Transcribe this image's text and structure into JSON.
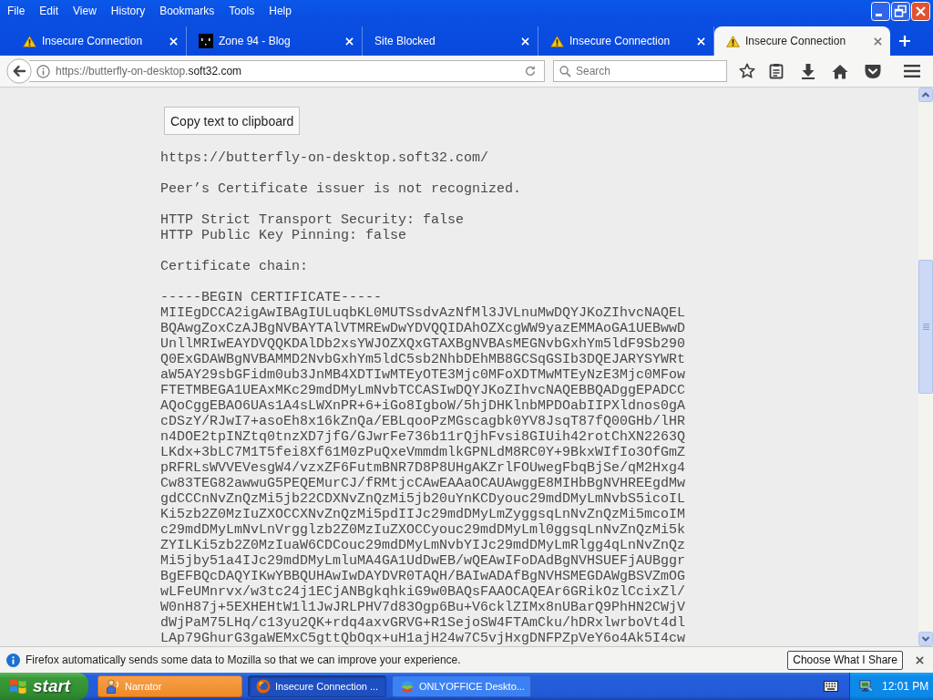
{
  "menu_bar": {
    "items": [
      "File",
      "Edit",
      "View",
      "History",
      "Bookmarks",
      "Tools",
      "Help"
    ]
  },
  "tabs": [
    {
      "title": "Insecure Connection",
      "kind": "warning",
      "selected": false
    },
    {
      "title": "Zone 94 - Blog",
      "kind": "site",
      "selected": false
    },
    {
      "title": "Site Blocked",
      "kind": "plain",
      "selected": false
    },
    {
      "title": "Insecure Connection",
      "kind": "warning",
      "selected": false
    },
    {
      "title": "Insecure Connection",
      "kind": "warning",
      "selected": true
    }
  ],
  "address_bar": {
    "url_prefix": "https://butterfly-on-desktop.",
    "url_domain": "soft32.com"
  },
  "search": {
    "placeholder": "Search"
  },
  "page": {
    "button": "Copy text to clipboard",
    "site_url": "https://butterfly-on-desktop.soft32.com/",
    "error": "Peer’s Certificate issuer is not recognized.",
    "security": [
      "HTTP Strict Transport Security: false",
      "HTTP Public Key Pinning: false"
    ],
    "chain_heading": "Certificate chain:",
    "certificate": [
      "-----BEGIN CERTIFICATE-----",
      "MIIEgDCCA2igAwIBAgIULuqbKL0MUTSsdvAzNfMl3JVLnuMwDQYJKoZIhvcNAQEL",
      "BQAwgZoxCzAJBgNVBAYTAlVTMREwDwYDVQQIDAhOZXcgWW9yazEMMAoGA1UEBwwD",
      "UnllMRIwEAYDVQQKDAlDb2xsYWJOZXQxGTAXBgNVBAsMEGNvbGxhYm5ldF9Sb290",
      "Q0ExGDAWBgNVBAMMD2NvbGxhYm5ldC5sb2NhbDEhMB8GCSqGSIb3DQEJARYSYWRt",
      "aW5AY29sbGFidm0ub3JnMB4XDTIwMTEyOTE3Mjc0MFoXDTMwMTEyNzE3Mjc0MFow",
      "FTETMBEGA1UEAxMKc29mdDMyLmNvbTCCASIwDQYJKoZIhvcNAQEBBQADggEPADCC",
      "AQoCggEBAO6UAs1A4sLWXnPR+6+iGo8IgboW/5hjDHKlnbMPDOabIIPXldnos0gA",
      "cDSzY/RJwI7+asoEh8x16kZnQa/EBLqooPzMGscagbk0YV8JsqT87fQ00GHb/lHR",
      "n4DOE2tpINZtq0tnzXD7jfG/GJwrFe736b11rQjhFvsi8GIUih42rotChXN2263Q",
      "LKdx+3bLC7M1T5fei8Xf61M0zPuQxeVmmdmlkGPNLdM8RC0Y+9BkxWIfIo3OfGmZ",
      "pRFRLsWVVEVesgW4/vzxZF6FutmBNR7D8P8UHgAKZrlFOUwegFbqBjSe/qM2Hxg4",
      "Cw83TEG82awwuG5PEQEMurCJ/fRMtjcCAwEAAaOCAUAwggE8MIHbBgNVHREEgdMw",
      "gdCCCnNvZnQzMi5jb22CDXNvZnQzMi5jb20uYnKCDyouc29mdDMyLmNvbS5icoIL",
      "Ki5zb2Z0MzIuZXOCCXNvZnQzMi5pdIIJc29mdDMyLmZyggsqLnNvZnQzMi5mcoIM",
      "c29mdDMyLmNvLnVrgglzb2Z0MzIuZXOCCyouc29mdDMyLml0ggsqLnNvZnQzMi5k",
      "ZYILKi5zb2Z0MzIuaW6CDCouc29mdDMyLmNvbYIJc29mdDMyLmRlgg4qLnNvZnQz",
      "Mi5jby51a4IJc29mdDMyLmluMA4GA1UdDwEB/wQEAwIFoDAdBgNVHSUEFjAUBggr",
      "BgEFBQcDAQYIKwYBBQUHAwIwDAYDVR0TAQH/BAIwADAfBgNVHSMEGDAWgBSVZmOG",
      "wLFeUMnrvx/w3tc24j1ECjANBgkqhkiG9w0BAQsFAAOCAQEAr6GRikOzlCcixZl/",
      "W0nH87j+5EXHEHtW1l1JwJRLPHV7d83Ogp6Bu+V6cklZIMx8nUBarQ9PhHN2CWjV",
      "dWjPaM75LHq/c13yu2QK+rdq4axvGRVG+R1SejoSW4FTAmCku/hDRxlwrboVt4dl",
      "LAp79GhurG3gaWEMxC5gttQbOqx+uH1ajH24w7C5vjHxgDNFPZpVeY6o4Ak5I4cw"
    ]
  },
  "notification_bar": {
    "message": "Firefox automatically sends some data to Mozilla so that we can improve your experience.",
    "button": "Choose What I Share"
  },
  "taskbar": {
    "start": "start",
    "tasks": [
      {
        "label": "Narrator",
        "kind": "narrator",
        "selected": false,
        "flashing": true
      },
      {
        "label": "Insecure Connection ...",
        "kind": "browser",
        "selected": true,
        "flashing": false
      },
      {
        "label": "ONLYOFFICE Deskto...",
        "kind": "office",
        "selected": false,
        "flashing": false
      }
    ],
    "clock": "12:01 PM"
  }
}
